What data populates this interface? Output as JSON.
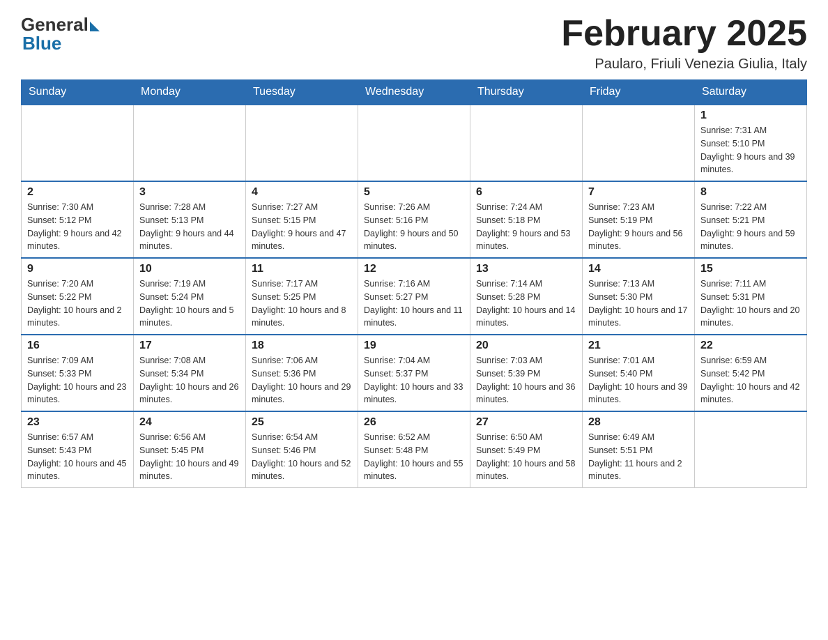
{
  "header": {
    "logo_general": "General",
    "logo_blue": "Blue",
    "month_title": "February 2025",
    "location": "Paularo, Friuli Venezia Giulia, Italy"
  },
  "weekdays": [
    "Sunday",
    "Monday",
    "Tuesday",
    "Wednesday",
    "Thursday",
    "Friday",
    "Saturday"
  ],
  "weeks": [
    [
      {
        "day": "",
        "sunrise": "",
        "sunset": "",
        "daylight": ""
      },
      {
        "day": "",
        "sunrise": "",
        "sunset": "",
        "daylight": ""
      },
      {
        "day": "",
        "sunrise": "",
        "sunset": "",
        "daylight": ""
      },
      {
        "day": "",
        "sunrise": "",
        "sunset": "",
        "daylight": ""
      },
      {
        "day": "",
        "sunrise": "",
        "sunset": "",
        "daylight": ""
      },
      {
        "day": "",
        "sunrise": "",
        "sunset": "",
        "daylight": ""
      },
      {
        "day": "1",
        "sunrise": "Sunrise: 7:31 AM",
        "sunset": "Sunset: 5:10 PM",
        "daylight": "Daylight: 9 hours and 39 minutes."
      }
    ],
    [
      {
        "day": "2",
        "sunrise": "Sunrise: 7:30 AM",
        "sunset": "Sunset: 5:12 PM",
        "daylight": "Daylight: 9 hours and 42 minutes."
      },
      {
        "day": "3",
        "sunrise": "Sunrise: 7:28 AM",
        "sunset": "Sunset: 5:13 PM",
        "daylight": "Daylight: 9 hours and 44 minutes."
      },
      {
        "day": "4",
        "sunrise": "Sunrise: 7:27 AM",
        "sunset": "Sunset: 5:15 PM",
        "daylight": "Daylight: 9 hours and 47 minutes."
      },
      {
        "day": "5",
        "sunrise": "Sunrise: 7:26 AM",
        "sunset": "Sunset: 5:16 PM",
        "daylight": "Daylight: 9 hours and 50 minutes."
      },
      {
        "day": "6",
        "sunrise": "Sunrise: 7:24 AM",
        "sunset": "Sunset: 5:18 PM",
        "daylight": "Daylight: 9 hours and 53 minutes."
      },
      {
        "day": "7",
        "sunrise": "Sunrise: 7:23 AM",
        "sunset": "Sunset: 5:19 PM",
        "daylight": "Daylight: 9 hours and 56 minutes."
      },
      {
        "day": "8",
        "sunrise": "Sunrise: 7:22 AM",
        "sunset": "Sunset: 5:21 PM",
        "daylight": "Daylight: 9 hours and 59 minutes."
      }
    ],
    [
      {
        "day": "9",
        "sunrise": "Sunrise: 7:20 AM",
        "sunset": "Sunset: 5:22 PM",
        "daylight": "Daylight: 10 hours and 2 minutes."
      },
      {
        "day": "10",
        "sunrise": "Sunrise: 7:19 AM",
        "sunset": "Sunset: 5:24 PM",
        "daylight": "Daylight: 10 hours and 5 minutes."
      },
      {
        "day": "11",
        "sunrise": "Sunrise: 7:17 AM",
        "sunset": "Sunset: 5:25 PM",
        "daylight": "Daylight: 10 hours and 8 minutes."
      },
      {
        "day": "12",
        "sunrise": "Sunrise: 7:16 AM",
        "sunset": "Sunset: 5:27 PM",
        "daylight": "Daylight: 10 hours and 11 minutes."
      },
      {
        "day": "13",
        "sunrise": "Sunrise: 7:14 AM",
        "sunset": "Sunset: 5:28 PM",
        "daylight": "Daylight: 10 hours and 14 minutes."
      },
      {
        "day": "14",
        "sunrise": "Sunrise: 7:13 AM",
        "sunset": "Sunset: 5:30 PM",
        "daylight": "Daylight: 10 hours and 17 minutes."
      },
      {
        "day": "15",
        "sunrise": "Sunrise: 7:11 AM",
        "sunset": "Sunset: 5:31 PM",
        "daylight": "Daylight: 10 hours and 20 minutes."
      }
    ],
    [
      {
        "day": "16",
        "sunrise": "Sunrise: 7:09 AM",
        "sunset": "Sunset: 5:33 PM",
        "daylight": "Daylight: 10 hours and 23 minutes."
      },
      {
        "day": "17",
        "sunrise": "Sunrise: 7:08 AM",
        "sunset": "Sunset: 5:34 PM",
        "daylight": "Daylight: 10 hours and 26 minutes."
      },
      {
        "day": "18",
        "sunrise": "Sunrise: 7:06 AM",
        "sunset": "Sunset: 5:36 PM",
        "daylight": "Daylight: 10 hours and 29 minutes."
      },
      {
        "day": "19",
        "sunrise": "Sunrise: 7:04 AM",
        "sunset": "Sunset: 5:37 PM",
        "daylight": "Daylight: 10 hours and 33 minutes."
      },
      {
        "day": "20",
        "sunrise": "Sunrise: 7:03 AM",
        "sunset": "Sunset: 5:39 PM",
        "daylight": "Daylight: 10 hours and 36 minutes."
      },
      {
        "day": "21",
        "sunrise": "Sunrise: 7:01 AM",
        "sunset": "Sunset: 5:40 PM",
        "daylight": "Daylight: 10 hours and 39 minutes."
      },
      {
        "day": "22",
        "sunrise": "Sunrise: 6:59 AM",
        "sunset": "Sunset: 5:42 PM",
        "daylight": "Daylight: 10 hours and 42 minutes."
      }
    ],
    [
      {
        "day": "23",
        "sunrise": "Sunrise: 6:57 AM",
        "sunset": "Sunset: 5:43 PM",
        "daylight": "Daylight: 10 hours and 45 minutes."
      },
      {
        "day": "24",
        "sunrise": "Sunrise: 6:56 AM",
        "sunset": "Sunset: 5:45 PM",
        "daylight": "Daylight: 10 hours and 49 minutes."
      },
      {
        "day": "25",
        "sunrise": "Sunrise: 6:54 AM",
        "sunset": "Sunset: 5:46 PM",
        "daylight": "Daylight: 10 hours and 52 minutes."
      },
      {
        "day": "26",
        "sunrise": "Sunrise: 6:52 AM",
        "sunset": "Sunset: 5:48 PM",
        "daylight": "Daylight: 10 hours and 55 minutes."
      },
      {
        "day": "27",
        "sunrise": "Sunrise: 6:50 AM",
        "sunset": "Sunset: 5:49 PM",
        "daylight": "Daylight: 10 hours and 58 minutes."
      },
      {
        "day": "28",
        "sunrise": "Sunrise: 6:49 AM",
        "sunset": "Sunset: 5:51 PM",
        "daylight": "Daylight: 11 hours and 2 minutes."
      },
      {
        "day": "",
        "sunrise": "",
        "sunset": "",
        "daylight": ""
      }
    ]
  ]
}
